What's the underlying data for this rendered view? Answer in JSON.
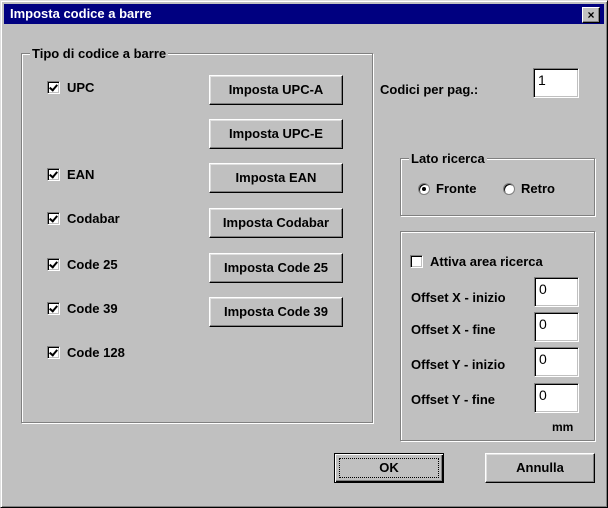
{
  "window": {
    "title": "Imposta codice a barre",
    "close_glyph": "×"
  },
  "barcode_group": {
    "legend": "Tipo di codice a barre",
    "items": [
      {
        "label": "UPC",
        "checked": true
      },
      {
        "label": "EAN",
        "checked": true
      },
      {
        "label": "Codabar",
        "checked": true
      },
      {
        "label": "Code 25",
        "checked": true
      },
      {
        "label": "Code 39",
        "checked": true
      },
      {
        "label": "Code 128",
        "checked": true
      }
    ],
    "buttons": [
      "Imposta UPC-A",
      "Imposta UPC-E",
      "Imposta EAN",
      "Imposta Codabar",
      "Imposta Code 25",
      "Imposta Code 39"
    ]
  },
  "codes_per_page": {
    "label": "Codici per pag.:",
    "value": "1"
  },
  "search_side": {
    "legend": "Lato ricerca",
    "options": [
      {
        "label": "Fronte",
        "selected": true
      },
      {
        "label": "Retro",
        "selected": false
      }
    ]
  },
  "search_area": {
    "enable_label": "Attiva area ricerca",
    "enabled": false,
    "fields": [
      {
        "label": "Offset X - inizio",
        "value": "0"
      },
      {
        "label": "Offset X - fine",
        "value": "0"
      },
      {
        "label": "Offset Y - inizio",
        "value": "0"
      },
      {
        "label": "Offset Y - fine",
        "value": "0"
      }
    ],
    "unit": "mm"
  },
  "footer": {
    "ok": "OK",
    "cancel": "Annulla"
  }
}
